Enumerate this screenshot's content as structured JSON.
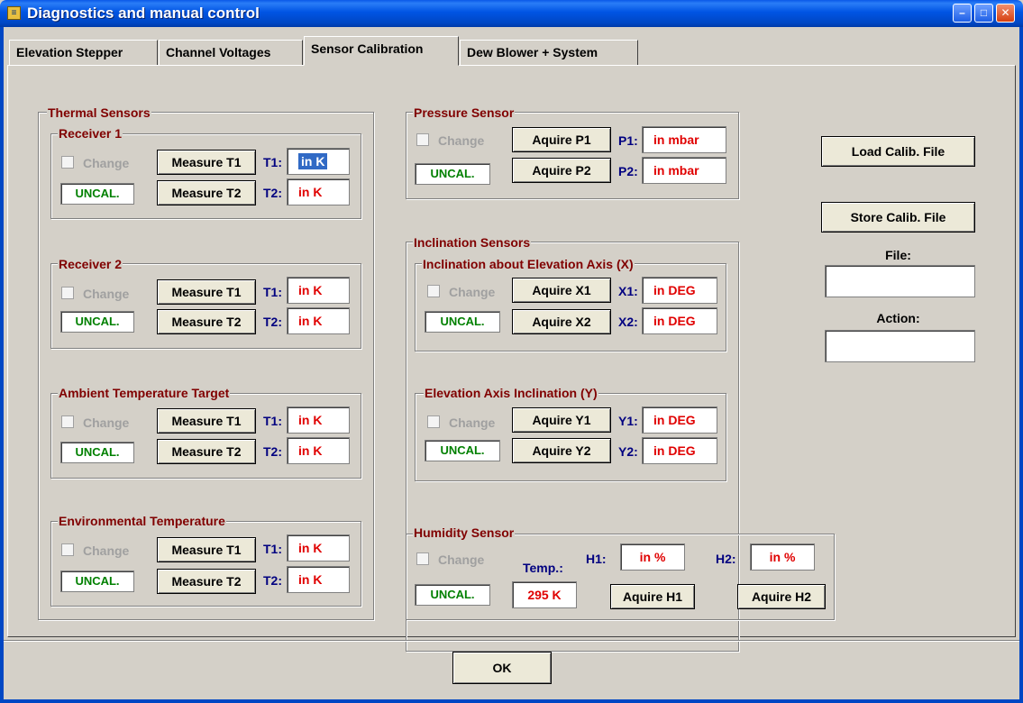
{
  "window": {
    "title": "Diagnostics and manual control",
    "icon": "app-logo-icon"
  },
  "tabs": [
    "Elevation Stepper",
    "Channel Voltages",
    "Sensor Calibration",
    "Dew Blower + System"
  ],
  "thermal": {
    "title": "Thermal Sensors",
    "groups": [
      {
        "title": "Receiver 1",
        "change": "Change",
        "status": "UNCAL.",
        "btn1": "Measure T1",
        "btn2": "Measure T2",
        "l1": "T1:",
        "l2": "T2:",
        "v1": "in K",
        "v2": "in K"
      },
      {
        "title": "Receiver 2",
        "change": "Change",
        "status": "UNCAL.",
        "btn1": "Measure T1",
        "btn2": "Measure T2",
        "l1": "T1:",
        "l2": "T2:",
        "v1": "in K",
        "v2": "in K"
      },
      {
        "title": "Ambient Temperature Target",
        "change": "Change",
        "status": "UNCAL.",
        "btn1": "Measure T1",
        "btn2": "Measure T2",
        "l1": "T1:",
        "l2": "T2:",
        "v1": "in K",
        "v2": "in K"
      },
      {
        "title": "Environmental Temperature",
        "change": "Change",
        "status": "UNCAL.",
        "btn1": "Measure T1",
        "btn2": "Measure T2",
        "l1": "T1:",
        "l2": "T2:",
        "v1": "in K",
        "v2": "in K"
      }
    ]
  },
  "pressure": {
    "title": "Pressure Sensor",
    "change": "Change",
    "status": "UNCAL.",
    "btn1": "Aquire P1",
    "btn2": "Aquire P2",
    "l1": "P1:",
    "l2": "P2:",
    "v1": "in mbar",
    "v2": "in mbar"
  },
  "inclination": {
    "title": "Inclination Sensors",
    "x": {
      "title": "Inclination about Elevation Axis (X)",
      "change": "Change",
      "status": "UNCAL.",
      "btn1": "Aquire X1",
      "btn2": "Aquire X2",
      "l1": "X1:",
      "l2": "X2:",
      "v1": "in DEG",
      "v2": "in DEG"
    },
    "y": {
      "title": "Elevation Axis Inclination (Y)",
      "change": "Change",
      "status": "UNCAL.",
      "btn1": "Aquire Y1",
      "btn2": "Aquire Y2",
      "l1": "Y1:",
      "l2": "Y2:",
      "v1": "in DEG",
      "v2": "in DEG"
    }
  },
  "humidity": {
    "title": "Humidity Sensor",
    "change": "Change",
    "status": "UNCAL.",
    "temp_label": "Temp.:",
    "temp_value": "295 K",
    "l1": "H1:",
    "l2": "H2:",
    "v1": "in %",
    "v2": "in %",
    "btn1": "Aquire H1",
    "btn2": "Aquire H2"
  },
  "calib": {
    "load": "Load Calib. File",
    "store": "Store Calib. File",
    "file_label": "File:",
    "action_label": "Action:",
    "file_value": "",
    "action_value": ""
  },
  "ok": "OK",
  "colors": {
    "title_blue": "#0054e3",
    "group_title": "#800000",
    "status_green": "#008000",
    "value_red": "#e00000",
    "label_navy": "#000080"
  }
}
